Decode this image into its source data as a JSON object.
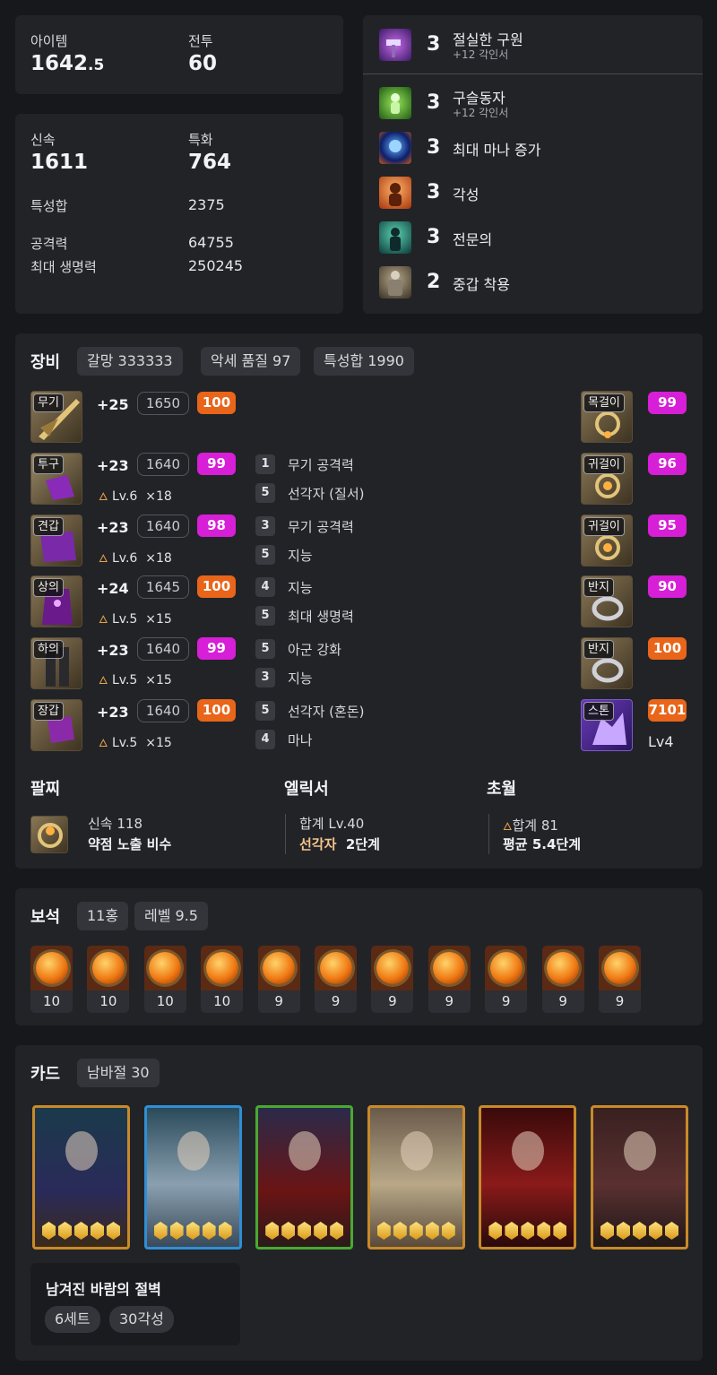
{
  "stats": {
    "item_label": "아이템",
    "item_value": "1642",
    "item_decimal": ".5",
    "combat_label": "전투",
    "combat_value": "60",
    "swift_label": "신속",
    "swift_value": "1611",
    "spec_label": "특화",
    "spec_value": "764",
    "sum_label": "특성합",
    "sum_value": "2375",
    "atk_label": "공격력",
    "atk_value": "64755",
    "hp_label": "최대 생명력",
    "hp_value": "250245"
  },
  "engravings": [
    {
      "level": "3",
      "name": "절실한 구원",
      "sub": "+12 각인서",
      "icon": "hammer-magic-icon"
    },
    {
      "level": "3",
      "name": "구슬동자",
      "sub": "+12 각인서",
      "icon": "green-orb-icon"
    },
    {
      "level": "3",
      "name": "최대 마나 증가",
      "sub": "",
      "icon": "mana-icon"
    },
    {
      "level": "3",
      "name": "각성",
      "sub": "",
      "icon": "awakening-icon"
    },
    {
      "level": "3",
      "name": "전문의",
      "sub": "",
      "icon": "doctor-icon"
    },
    {
      "level": "2",
      "name": "중갑 착용",
      "sub": "",
      "icon": "heavy-armor-icon"
    }
  ],
  "equipment": {
    "title": "장비",
    "pills": [
      "갈망 333333",
      "악세 품질 97",
      "특성합 1990"
    ],
    "items": [
      {
        "tag": "무기",
        "plus": "+25",
        "ilvl": "1650",
        "quality": "100",
        "qcolor": "orange",
        "sub_lv": "",
        "sub_mult": "",
        "opts": []
      },
      {
        "tag": "투구",
        "plus": "+23",
        "ilvl": "1640",
        "quality": "99",
        "qcolor": "pink",
        "sub_lv": "Lv.6",
        "sub_mult": "×18",
        "opts": [
          {
            "n": "1",
            "t": "무기 공격력"
          },
          {
            "n": "5",
            "t": "선각자 (질서)"
          }
        ]
      },
      {
        "tag": "견갑",
        "plus": "+23",
        "ilvl": "1640",
        "quality": "98",
        "qcolor": "pink",
        "sub_lv": "Lv.6",
        "sub_mult": "×18",
        "opts": [
          {
            "n": "3",
            "t": "무기 공격력"
          },
          {
            "n": "5",
            "t": "지능"
          }
        ]
      },
      {
        "tag": "상의",
        "plus": "+24",
        "ilvl": "1645",
        "quality": "100",
        "qcolor": "orange",
        "sub_lv": "Lv.5",
        "sub_mult": "×15",
        "opts": [
          {
            "n": "4",
            "t": "지능"
          },
          {
            "n": "5",
            "t": "최대 생명력"
          }
        ]
      },
      {
        "tag": "하의",
        "plus": "+23",
        "ilvl": "1640",
        "quality": "99",
        "qcolor": "pink",
        "sub_lv": "Lv.5",
        "sub_mult": "×15",
        "opts": [
          {
            "n": "5",
            "t": "아군 강화"
          },
          {
            "n": "3",
            "t": "지능"
          }
        ]
      },
      {
        "tag": "장갑",
        "plus": "+23",
        "ilvl": "1640",
        "quality": "100",
        "qcolor": "orange",
        "sub_lv": "Lv.5",
        "sub_mult": "×15",
        "opts": [
          {
            "n": "5",
            "t": "선각자 (혼돈)"
          },
          {
            "n": "4",
            "t": "마나"
          }
        ]
      }
    ],
    "accessories": [
      {
        "tag": "목걸이",
        "quality": "99",
        "qcolor": "pink"
      },
      {
        "tag": "귀걸이",
        "quality": "96",
        "qcolor": "pink"
      },
      {
        "tag": "귀걸이",
        "quality": "95",
        "qcolor": "pink"
      },
      {
        "tag": "반지",
        "quality": "90",
        "qcolor": "pink"
      },
      {
        "tag": "반지",
        "quality": "100",
        "qcolor": "orange"
      },
      {
        "tag": "스톤",
        "quality": "7101",
        "qcolor": "orange",
        "extra": "Lv4"
      }
    ],
    "bracelet": {
      "title": "팔찌",
      "line1": "신속 118",
      "line2": "약점 노출  비수"
    },
    "elixir": {
      "title": "엘릭서",
      "line1": "합계 Lv.40",
      "name": "선각자",
      "stage": "2단계"
    },
    "transcend": {
      "title": "초월",
      "line1": "합계 81",
      "line2": "평균 5.4단계"
    }
  },
  "gems": {
    "title": "보석",
    "pills": [
      "11홍",
      "레벨 9.5"
    ],
    "levels": [
      "10",
      "10",
      "10",
      "10",
      "9",
      "9",
      "9",
      "9",
      "9",
      "9",
      "9"
    ]
  },
  "cards": {
    "title": "카드",
    "pill": "남바절 30",
    "set_name": "남겨진 바람의 절벽",
    "set_pills": [
      "6세트",
      "30각성"
    ],
    "borders": [
      "#c88a2a",
      "#2f8fd6",
      "#4aa832",
      "#c88a2a",
      "#c88a2a",
      "#c88a2a"
    ],
    "awaken": [
      5,
      5,
      5,
      5,
      5,
      5
    ]
  }
}
